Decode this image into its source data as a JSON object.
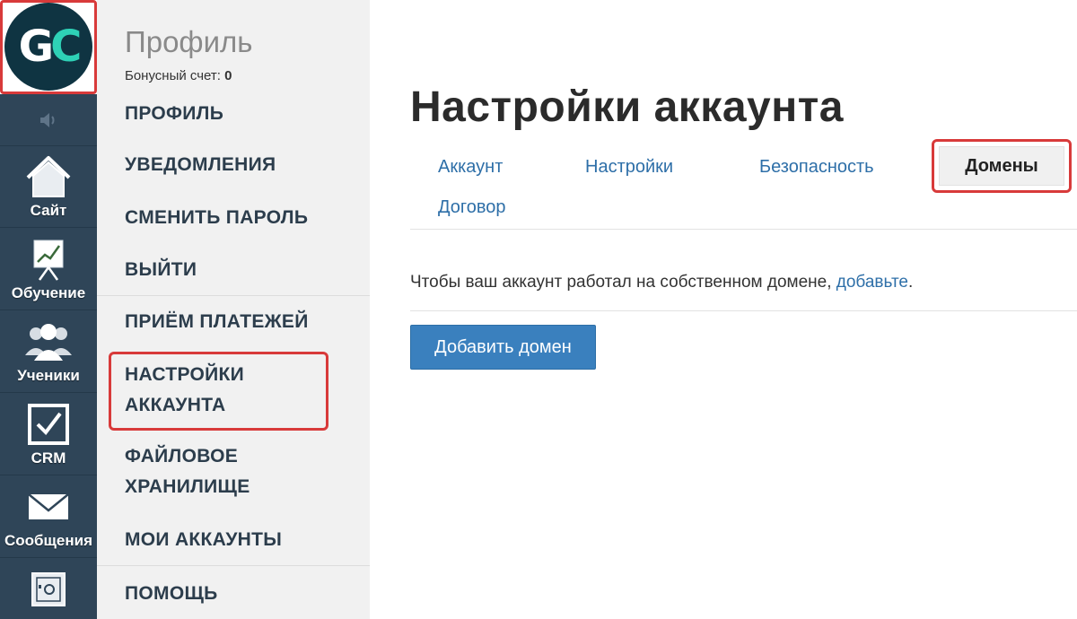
{
  "logo": {
    "letter1": "G",
    "letter2": "C"
  },
  "rail": {
    "items": [
      {
        "label": "Сайт",
        "icon": "house-icon"
      },
      {
        "label": "Обучение",
        "icon": "chart-board-icon"
      },
      {
        "label": "Ученики",
        "icon": "users-icon"
      },
      {
        "label": "CRM",
        "icon": "checkbox-icon"
      },
      {
        "label": "Сообщения",
        "icon": "envelope-icon"
      },
      {
        "label": "",
        "icon": "safe-icon"
      }
    ]
  },
  "menu": {
    "title": "Профиль",
    "bonus_label": "Бонусный счет:",
    "bonus_value": "0",
    "items": [
      "ПРОФИЛЬ",
      "УВЕДОМЛЕНИЯ",
      "СМЕНИТЬ ПАРОЛЬ",
      "ВЫЙТИ",
      "ПРИЁМ ПЛАТЕЖЕЙ",
      "НАСТРОЙКИ",
      "АККАУНТА",
      "ФАЙЛОВОЕ",
      "ХРАНИЛИЩЕ",
      "МОИ АККАУНТЫ",
      "ПОМОЩЬ"
    ]
  },
  "main": {
    "title": "Настройки аккаунта",
    "tabs": [
      "Аккаунт",
      "Настройки",
      "Безопасность",
      "Домены",
      "Договор"
    ],
    "active_tab": "Домены",
    "info_text": "Чтобы ваш аккаунт работал на собственном домене, ",
    "info_link": "добавьте",
    "info_end": ".",
    "add_button": "Добавить домен"
  },
  "colors": {
    "rail": "#2f4558",
    "accent": "#3a80be",
    "link": "#2e6fa8",
    "highlight": "#d83a3a"
  }
}
